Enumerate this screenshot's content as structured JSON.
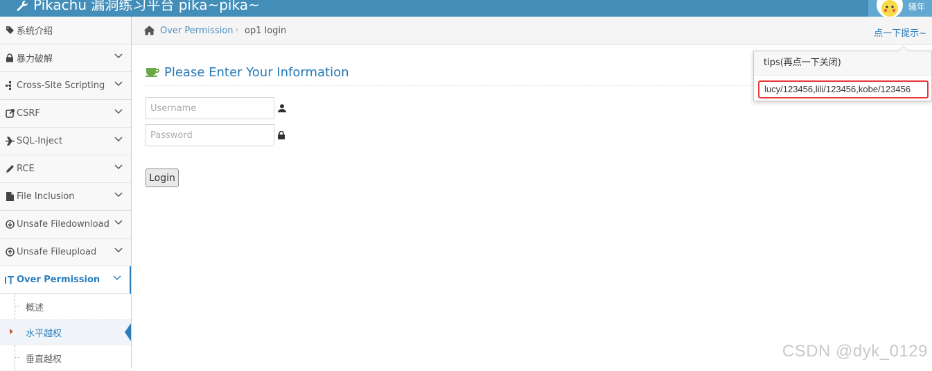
{
  "app": {
    "brand_title": "Pikachu 漏洞练习平台 pika~pika~",
    "user_name": "骚年"
  },
  "sidebar": {
    "items": [
      {
        "label": "系统介绍",
        "icon": "tag-icon"
      },
      {
        "label": "暴力破解",
        "icon": "lock-icon"
      },
      {
        "label": "Cross-Site Scripting",
        "icon": "sitemap-icon"
      },
      {
        "label": "CSRF",
        "icon": "share-icon"
      },
      {
        "label": "SQL-Inject",
        "icon": "plane-icon"
      },
      {
        "label": "RCE",
        "icon": "pencil-icon"
      },
      {
        "label": "File Inclusion",
        "icon": "file-icon"
      },
      {
        "label": "Unsafe Filedownload",
        "icon": "download-circle-icon"
      },
      {
        "label": "Unsafe Fileupload",
        "icon": "upload-circle-icon"
      },
      {
        "label": "Over Permission",
        "icon": "text-cursor-icon"
      }
    ],
    "sub_items": [
      {
        "label": "概述"
      },
      {
        "label": "水平越权"
      },
      {
        "label": "垂直越权"
      }
    ]
  },
  "breadcrumb": {
    "parent": "Over Permission",
    "current": "op1 login",
    "tip_link": "点一下提示~"
  },
  "main": {
    "heading": "Please Enter Your Information",
    "username_placeholder": "Username",
    "password_placeholder": "Password",
    "login_label": "Login"
  },
  "popover": {
    "title": "tips(再点一下关闭)",
    "content": "lucy/123456,lili/123456,kobe/123456"
  },
  "watermark": "CSDN @dyk_0129",
  "colors": {
    "navbar": "#438eb9",
    "accent": "#2b7dbc",
    "highlight_border": "#e53935"
  }
}
